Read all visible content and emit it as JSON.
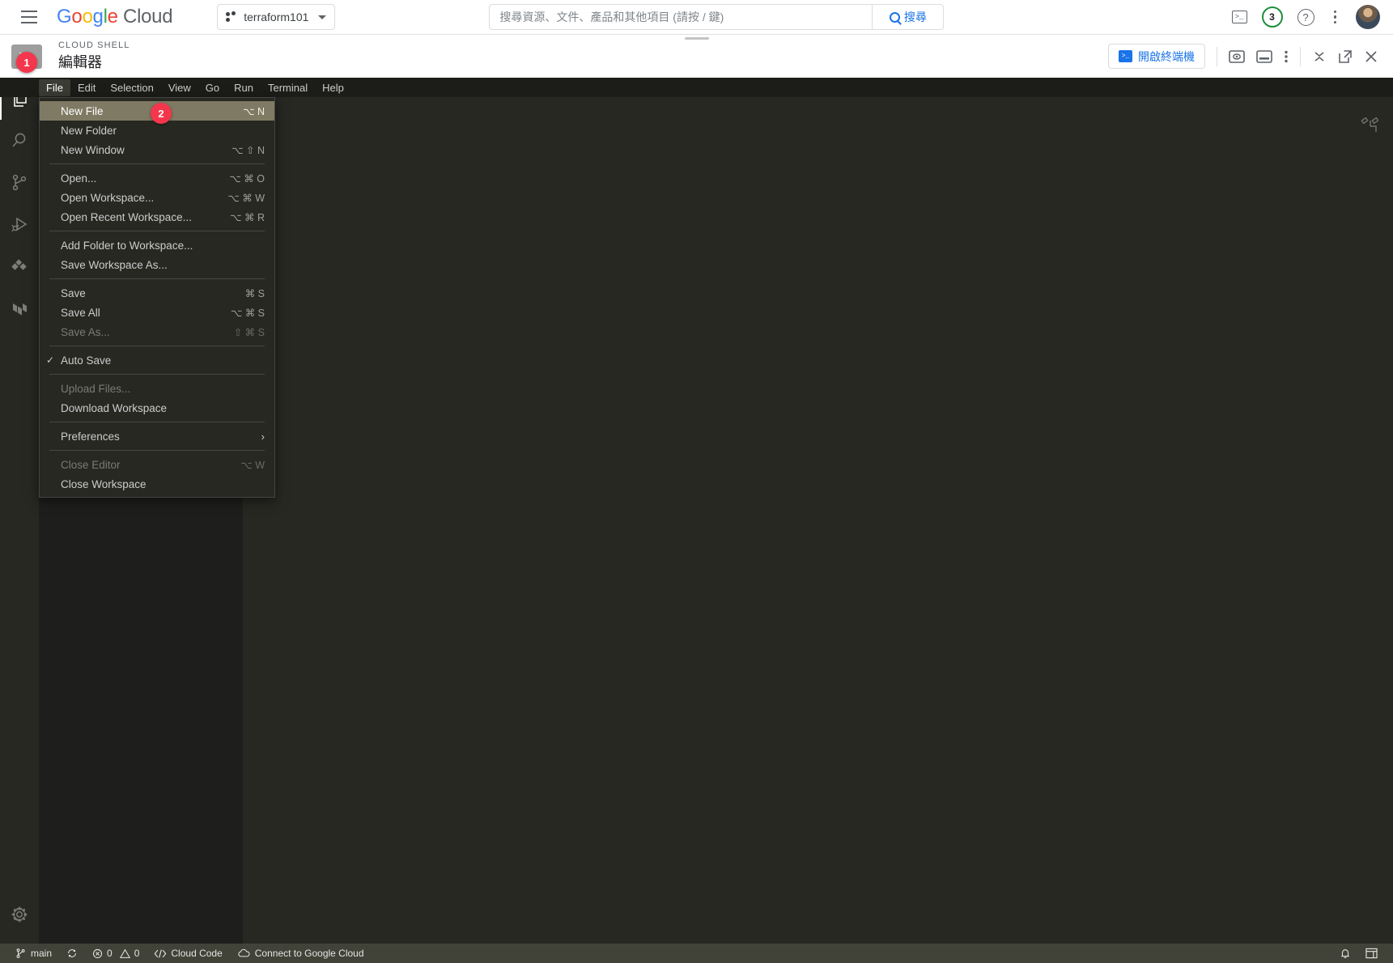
{
  "header": {
    "logo": {
      "g1": "G",
      "o1": "o",
      "o2": "o",
      "g2": "g",
      "l": "l",
      "e": "e",
      "cloud": " Cloud"
    },
    "project": "terraform101",
    "search": {
      "placeholder": "搜尋資源、文件、產品和其他項目 (請按 / 鍵)",
      "value": "",
      "button_label": "搜尋"
    },
    "icons": {
      "terminal": ">_",
      "notifications_count": "3",
      "help": "?"
    }
  },
  "cloudshell": {
    "eyebrow": "CLOUD SHELL",
    "title": "編輯器",
    "shell_glyph": ">_",
    "open_terminal_label": "開啟終端機",
    "open_terminal_glyph": ">_"
  },
  "menubar": {
    "items": [
      {
        "label": "File",
        "active": true
      },
      {
        "label": "Edit",
        "active": false
      },
      {
        "label": "Selection",
        "active": false
      },
      {
        "label": "View",
        "active": false
      },
      {
        "label": "Go",
        "active": false
      },
      {
        "label": "Run",
        "active": false
      },
      {
        "label": "Terminal",
        "active": false
      },
      {
        "label": "Help",
        "active": false
      }
    ]
  },
  "activitybar": {
    "items": [
      {
        "name": "explorer",
        "selected": true
      },
      {
        "name": "search",
        "selected": false
      },
      {
        "name": "source-control",
        "selected": false
      },
      {
        "name": "run-and-debug",
        "selected": false
      },
      {
        "name": "extensions",
        "selected": false
      },
      {
        "name": "terraform",
        "selected": false
      }
    ],
    "settings": "manage-settings"
  },
  "file_menu": {
    "rows": [
      {
        "type": "item",
        "label": "New File",
        "key": "⌥ N",
        "highlight": true,
        "disabled": false,
        "check": false,
        "submenu": false
      },
      {
        "type": "item",
        "label": "New Folder",
        "key": "",
        "highlight": false,
        "disabled": false,
        "check": false,
        "submenu": false
      },
      {
        "type": "item",
        "label": "New Window",
        "key": "⌥ ⇧ N",
        "highlight": false,
        "disabled": false,
        "check": false,
        "submenu": false
      },
      {
        "type": "sep"
      },
      {
        "type": "item",
        "label": "Open...",
        "key": "⌥ ⌘ O",
        "highlight": false,
        "disabled": false,
        "check": false,
        "submenu": false
      },
      {
        "type": "item",
        "label": "Open Workspace...",
        "key": "⌥ ⌘ W",
        "highlight": false,
        "disabled": false,
        "check": false,
        "submenu": false
      },
      {
        "type": "item",
        "label": "Open Recent Workspace...",
        "key": "⌥ ⌘ R",
        "highlight": false,
        "disabled": false,
        "check": false,
        "submenu": false
      },
      {
        "type": "sep"
      },
      {
        "type": "item",
        "label": "Add Folder to Workspace...",
        "key": "",
        "highlight": false,
        "disabled": false,
        "check": false,
        "submenu": false
      },
      {
        "type": "item",
        "label": "Save Workspace As...",
        "key": "",
        "highlight": false,
        "disabled": false,
        "check": false,
        "submenu": false
      },
      {
        "type": "sep"
      },
      {
        "type": "item",
        "label": "Save",
        "key": "⌘ S",
        "highlight": false,
        "disabled": false,
        "check": false,
        "submenu": false
      },
      {
        "type": "item",
        "label": "Save All",
        "key": "⌥ ⌘ S",
        "highlight": false,
        "disabled": false,
        "check": false,
        "submenu": false
      },
      {
        "type": "item",
        "label": "Save As...",
        "key": "⇧ ⌘ S",
        "highlight": false,
        "disabled": true,
        "check": false,
        "submenu": false
      },
      {
        "type": "sep"
      },
      {
        "type": "item",
        "label": "Auto Save",
        "key": "",
        "highlight": false,
        "disabled": false,
        "check": true,
        "submenu": false
      },
      {
        "type": "sep"
      },
      {
        "type": "item",
        "label": "Upload Files...",
        "key": "",
        "highlight": false,
        "disabled": true,
        "check": false,
        "submenu": false
      },
      {
        "type": "item",
        "label": "Download Workspace",
        "key": "",
        "highlight": false,
        "disabled": false,
        "check": false,
        "submenu": false
      },
      {
        "type": "sep"
      },
      {
        "type": "item",
        "label": "Preferences",
        "key": "",
        "highlight": false,
        "disabled": false,
        "check": false,
        "submenu": true
      },
      {
        "type": "sep"
      },
      {
        "type": "item",
        "label": "Close Editor",
        "key": "⌥ W",
        "highlight": false,
        "disabled": true,
        "check": false,
        "submenu": false
      },
      {
        "type": "item",
        "label": "Close Workspace",
        "key": "",
        "highlight": false,
        "disabled": false,
        "check": false,
        "submenu": false
      }
    ]
  },
  "statusbar": {
    "branch": "main",
    "errors": "0",
    "warnings": "0",
    "cloud_code": "Cloud Code",
    "connect": "Connect to Google Cloud"
  },
  "callouts": [
    {
      "number": "1"
    },
    {
      "number": "2"
    }
  ],
  "colors": {
    "editor_bg": "#272822",
    "sidebar_bg": "#1e1f1c",
    "menubar_bg": "#1c1d19",
    "statusbar_bg": "#414339",
    "menu_highlight": "#7f7a63",
    "callout": "#f4364c",
    "google_blue": "#1a73e8",
    "google_green": "#1e8e3e"
  }
}
